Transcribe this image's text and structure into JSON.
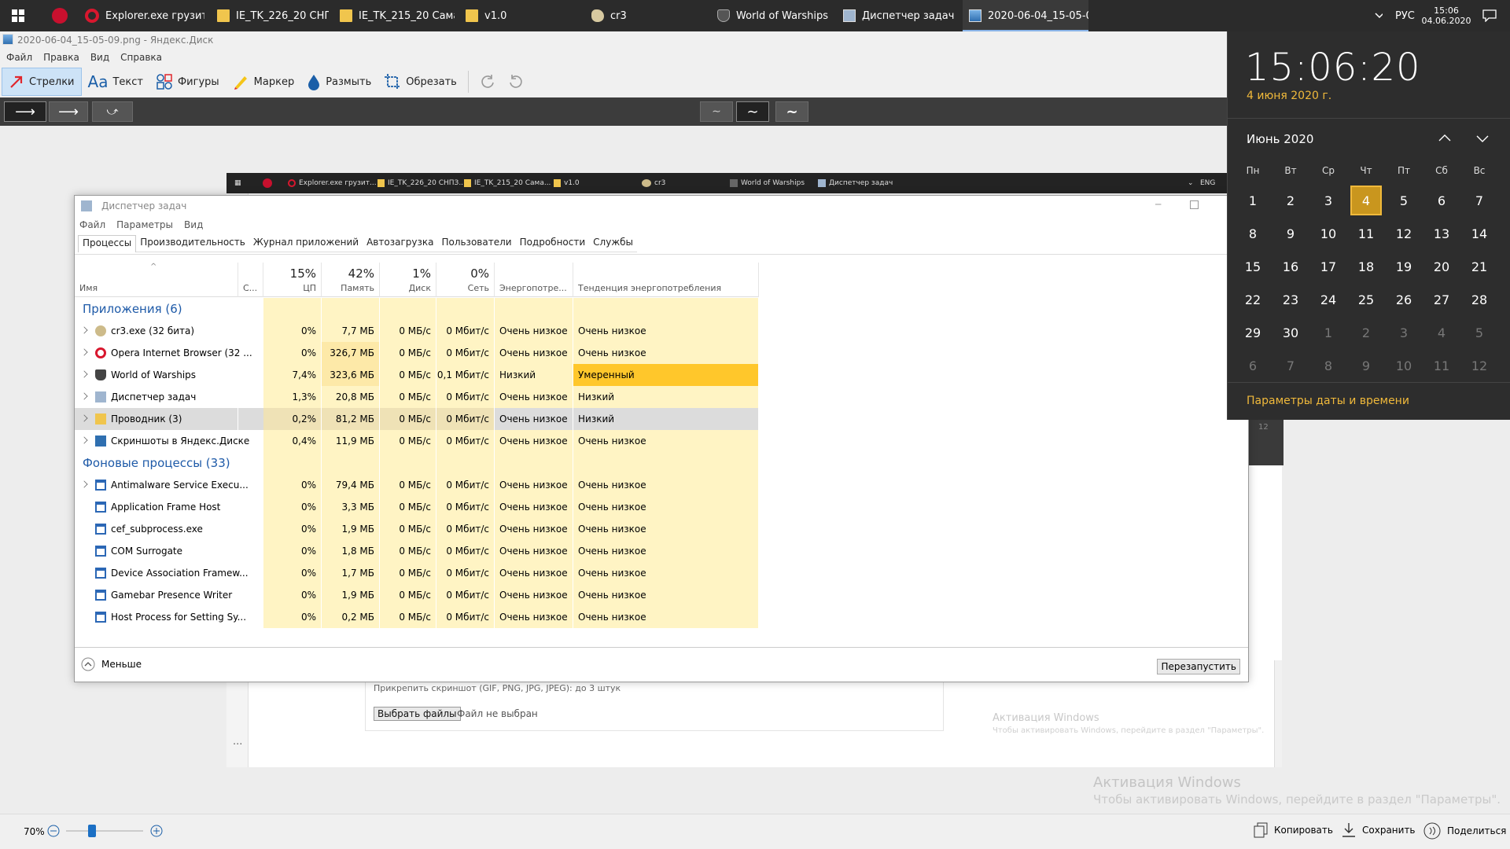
{
  "taskbar": {
    "items": [
      {
        "label": "Explorer.exe грузит...",
        "icon": "opera-icon"
      },
      {
        "label": "IE_TK_226_20 СНПЗ...",
        "icon": "folder-icon"
      },
      {
        "label": "IE_TK_215_20 Сама...",
        "icon": "folder-icon"
      },
      {
        "label": "v1.0",
        "icon": "folder-icon"
      },
      {
        "label": "cr3",
        "icon": "cr3-icon"
      },
      {
        "label": "World of Warships",
        "icon": "warships-icon"
      },
      {
        "label": "Диспетчер задач",
        "icon": "task-manager-icon"
      },
      {
        "label": "2020-06-04_15-05-0...",
        "icon": "image-icon"
      }
    ],
    "lang": "РУС",
    "time": "15:06",
    "date": "04.06.2020"
  },
  "editor": {
    "title": "2020-06-04_15-05-09.png - Яндекс.Диск",
    "menu": [
      "Файл",
      "Правка",
      "Вид",
      "Справка"
    ],
    "tools": [
      "Стрелки",
      "Текст",
      "Фигуры",
      "Маркер",
      "Размыть",
      "Обрезать"
    ],
    "zoom": "70%",
    "bottom_actions": [
      "Копировать",
      "Сохранить",
      "Поделиться"
    ],
    "watermark_title": "Активация Windows",
    "watermark_text": "Чтобы активировать Windows, перейдите в раздел \"Параметры\"."
  },
  "inner_screenshot": {
    "taskbar_items": [
      "Explorer.exe грузит...",
      "IE_TK_226_20 СНПЗ...",
      "IE_TK_215_20 Сама...",
      "v1.0",
      "cr3",
      "World of Warships",
      "Диспетчер задач"
    ],
    "lang": "ENG",
    "attach_text": "Прикрепить скриншот (GIF, PNG, JPG, JPEG): до 3 штук",
    "choose_button": "Выбрать файлы",
    "no_file": "Файл не выбран",
    "watermark_title": "Активация Windows",
    "watermark_text": "Чтобы активировать Windows, перейдите в раздел \"Параметры\".",
    "side_value": "12",
    "ellipsis": "..."
  },
  "task_manager": {
    "title": "Диспетчер задач",
    "menu": [
      "Файл",
      "Параметры",
      "Вид"
    ],
    "tabs": [
      "Процессы",
      "Производительность",
      "Журнал приложений",
      "Автозагрузка",
      "Пользователи",
      "Подробности",
      "Службы"
    ],
    "headers": {
      "name": "Имя",
      "status": "С...",
      "cpu_pct": "15%",
      "cpu": "ЦП",
      "mem_pct": "42%",
      "mem": "Память",
      "disk_pct": "1%",
      "disk": "Диск",
      "net_pct": "0%",
      "net": "Сеть",
      "power": "Энергопотре...",
      "power_trend": "Тенденция энергопотребления"
    },
    "groups": [
      {
        "label": "Приложения (6)",
        "rows": [
          {
            "name": "cr3.exe (32 бита)",
            "icon": "cr3",
            "cpu": "0%",
            "mem": "7,7 МБ",
            "disk": "0 МБ/с",
            "net": "0 Мбит/с",
            "power": "Очень низкое",
            "trend": "Очень низкое",
            "exp": true
          },
          {
            "name": "Opera Internet Browser (32 ...",
            "icon": "opera",
            "cpu": "0%",
            "mem": "326,7 МБ",
            "disk": "0 МБ/с",
            "net": "0 Мбит/с",
            "power": "Очень низкое",
            "trend": "Очень низкое",
            "exp": true
          },
          {
            "name": "World of Warships",
            "icon": "wows",
            "cpu": "7,4%",
            "mem": "323,6 МБ",
            "disk": "0 МБ/с",
            "net": "0,1 Мбит/с",
            "power": "Низкий",
            "trend": "Умеренный",
            "exp": true
          },
          {
            "name": "Диспетчер задач",
            "icon": "tm",
            "cpu": "1,3%",
            "mem": "20,8 МБ",
            "disk": "0 МБ/с",
            "net": "0 Мбит/с",
            "power": "Очень низкое",
            "trend": "Низкий",
            "exp": true
          },
          {
            "name": "Проводник (3)",
            "icon": "exp",
            "cpu": "0,2%",
            "mem": "81,2 МБ",
            "disk": "0 МБ/с",
            "net": "0 Мбит/с",
            "power": "Очень низкое",
            "trend": "Низкий",
            "exp": true,
            "selected": true
          },
          {
            "name": "Скриншоты в Яндекс.Диске",
            "icon": "ya",
            "cpu": "0,4%",
            "mem": "11,9 МБ",
            "disk": "0 МБ/с",
            "net": "0 Мбит/с",
            "power": "Очень низкое",
            "trend": "Очень низкое",
            "exp": true
          }
        ]
      },
      {
        "label": "Фоновые процессы (33)",
        "rows": [
          {
            "name": "Antimalware Service Execu...",
            "icon": "app",
            "cpu": "0%",
            "mem": "79,4 МБ",
            "disk": "0 МБ/с",
            "net": "0 Мбит/с",
            "power": "Очень низкое",
            "trend": "Очень низкое",
            "exp": true
          },
          {
            "name": "Application Frame Host",
            "icon": "app",
            "cpu": "0%",
            "mem": "3,3 МБ",
            "disk": "0 МБ/с",
            "net": "0 Мбит/с",
            "power": "Очень низкое",
            "trend": "Очень низкое"
          },
          {
            "name": "cef_subprocess.exe",
            "icon": "app",
            "cpu": "0%",
            "mem": "1,9 МБ",
            "disk": "0 МБ/с",
            "net": "0 Мбит/с",
            "power": "Очень низкое",
            "trend": "Очень низкое"
          },
          {
            "name": "COM Surrogate",
            "icon": "app",
            "cpu": "0%",
            "mem": "1,8 МБ",
            "disk": "0 МБ/с",
            "net": "0 Мбит/с",
            "power": "Очень низкое",
            "trend": "Очень низкое"
          },
          {
            "name": "Device Association Framew...",
            "icon": "app",
            "cpu": "0%",
            "mem": "1,7 МБ",
            "disk": "0 МБ/с",
            "net": "0 Мбит/с",
            "power": "Очень низкое",
            "trend": "Очень низкое"
          },
          {
            "name": "Gamebar Presence Writer",
            "icon": "app",
            "cpu": "0%",
            "mem": "1,9 МБ",
            "disk": "0 МБ/с",
            "net": "0 Мбит/с",
            "power": "Очень низкое",
            "trend": "Очень низкое"
          },
          {
            "name": "Host Process for Setting Sy...",
            "icon": "app",
            "cpu": "0%",
            "mem": "0,2 МБ",
            "disk": "0 МБ/с",
            "net": "0 Мбит/с",
            "power": "Очень низкое",
            "trend": "Очень низкое"
          }
        ]
      }
    ],
    "less": "Меньше",
    "restart": "Перезапустить",
    "colors": {
      "cell_light": "#fff4c4",
      "cell_mid": "#fde9a8",
      "cell_strong": "#ffd35c",
      "selected": "#dcdcdc",
      "trend_high": "#ffc72b"
    }
  },
  "calendar": {
    "time": "15:06:20",
    "date_long": "4 июня 2020 г.",
    "month": "Июнь 2020",
    "weekdays": [
      "Пн",
      "Вт",
      "Ср",
      "Чт",
      "Пт",
      "Сб",
      "Вс"
    ],
    "weeks": [
      [
        "1",
        "2",
        "3",
        "4",
        "5",
        "6",
        "7"
      ],
      [
        "8",
        "9",
        "10",
        "11",
        "12",
        "13",
        "14"
      ],
      [
        "15",
        "16",
        "17",
        "18",
        "19",
        "20",
        "21"
      ],
      [
        "22",
        "23",
        "24",
        "25",
        "26",
        "27",
        "28"
      ],
      [
        "29",
        "30",
        "1",
        "2",
        "3",
        "4",
        "5"
      ],
      [
        "6",
        "7",
        "8",
        "9",
        "10",
        "11",
        "12"
      ]
    ],
    "today": "4",
    "settings_link": "Параметры даты и времени",
    "accent": "#f0b93b"
  }
}
